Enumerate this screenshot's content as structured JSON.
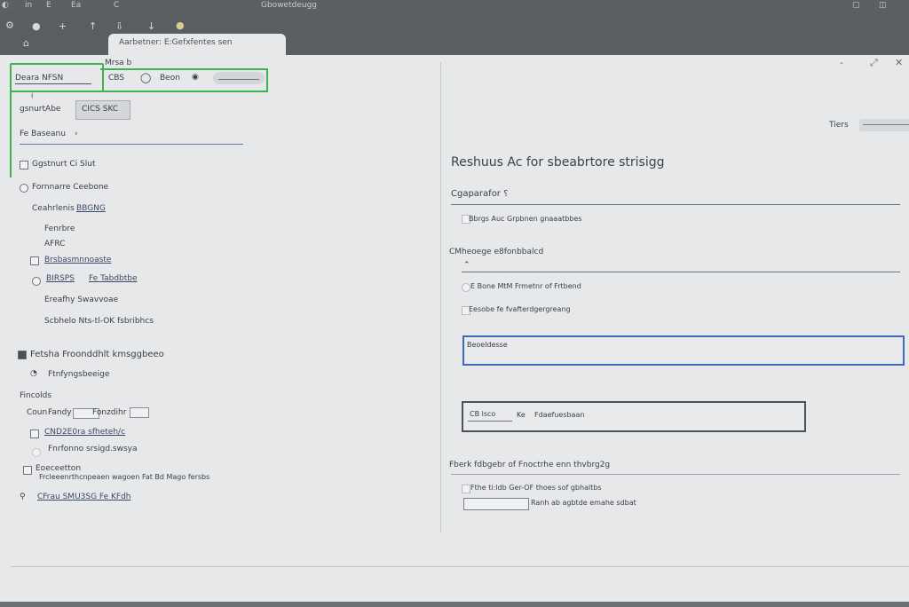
{
  "topbar": {
    "title": "Gbowetdeugg",
    "items": [
      "in",
      "E",
      "Ea",
      "C"
    ]
  },
  "tab": {
    "label": "Aarbetner: E:Gefxfentes sen"
  },
  "window": {
    "minimize": "-",
    "restore": "⤢",
    "close": "✕"
  },
  "left": {
    "header_small": "Mrsa b",
    "search": {
      "value": "Deara NFSN"
    },
    "search_suffix": "CBS",
    "search_button": "Beon",
    "field_a": "gsnurtAbe",
    "btn_small": "CICS SKC",
    "field_b": "Fe Baseanu",
    "row1": "Ggstnurt Ci Slut",
    "row2": "Fornnarre Ceebone",
    "row3_a": "Ceahrlenis",
    "row3_b": "BBGNG",
    "row4": "Fenrbre",
    "row5": "AFRC",
    "row6": "Brsbasmnnoaste",
    "row7_a": "BIRSPS",
    "row7_b": "Fe Tabdbtbe",
    "row8": "Ereafhy Swavvoae",
    "row9": "Scbhelo Nts-tl-OK fsbribhcs",
    "section2": "Fetsha Froonddhlt kmsggbeeo",
    "row10": "Ftnfyngsbeeige",
    "row11": "Fincolds",
    "row12_a": "Coun",
    "row12_b": "Fandy",
    "row12_c": "Fonzdihr",
    "row13": "CND2E0ra sfheteh/c",
    "row14": "Fnrfonno srsigd.swsya",
    "row15_a": "Eoeceetton",
    "row15_b": "Frcleeenrthcnpeaen wagoen Fat Bd Mago fersbs",
    "row16": "CFrau SMU3SG Fe KFdh"
  },
  "right": {
    "ticks_label": "Tiers",
    "heading": "Reshuus Ac for sbeabrtore strisigg",
    "sub1": "Cgaparafor ⸮",
    "opt1": "Bbrgs Auc Grpbnen gnaaatbbes",
    "sub2": "CMheoege e8fonbbalcd",
    "opt2": "E Bone MtM Frmetnr of Frtbend",
    "opt3": "Eesobe fe fvafterdgergreang",
    "selected_field": "Beoeldesse",
    "field_label": "CB lsco",
    "field_x": "Ke",
    "field_text": "Fdaefuesbaan",
    "section3": "Fberk fdbgebr of Fnoctrhe enn thvbrg2g",
    "opt4": "Fthe ti:ldb Ger-OF thoes sof gbhaltbs",
    "opt5": "Ranh ab agbtde emahe sdbat"
  }
}
